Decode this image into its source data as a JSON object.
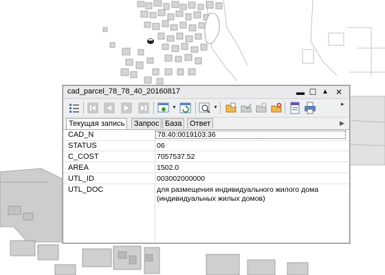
{
  "window": {
    "title": "cad_parcel_78_78_40_20160817",
    "buttons": {
      "minimize": "▬",
      "maximize": "☐",
      "collapse": "▲",
      "close": "✕"
    }
  },
  "toolbar": {
    "icons": [
      "list-icon",
      "first-record-icon",
      "previous-record-icon",
      "next-record-icon",
      "last-record-icon",
      "select-layer-icon",
      "refresh-icon",
      "zoom-to-icon",
      "open-folder-icon",
      "check-edit-icon",
      "add-folder-icon",
      "delete-folder-icon",
      "export-icon",
      "print-icon"
    ]
  },
  "tabs": [
    {
      "label": "Текущая запись",
      "active": true
    },
    {
      "label": "Запрос",
      "active": false
    },
    {
      "label": "База",
      "active": false
    },
    {
      "label": "Ответ",
      "active": false
    }
  ],
  "attributes": [
    {
      "name": "CAD_N",
      "value": "78:40:0019103:36"
    },
    {
      "name": "STATUS",
      "value": "06"
    },
    {
      "name": "C_COST",
      "value": "7057537.52"
    },
    {
      "name": "AREA",
      "value": "1502.0"
    },
    {
      "name": "UTL_ID",
      "value": "003002000000"
    },
    {
      "name": "UTL_DOC",
      "value": "для размещения индивидуального жилого дома (индивидуальных жилых домов)"
    }
  ],
  "colors": {
    "map_background": "#ffffff",
    "parcel_fill": "#d4d4d4",
    "parcel_stroke": "#9e9e9e",
    "water": "#e8e8e8"
  }
}
